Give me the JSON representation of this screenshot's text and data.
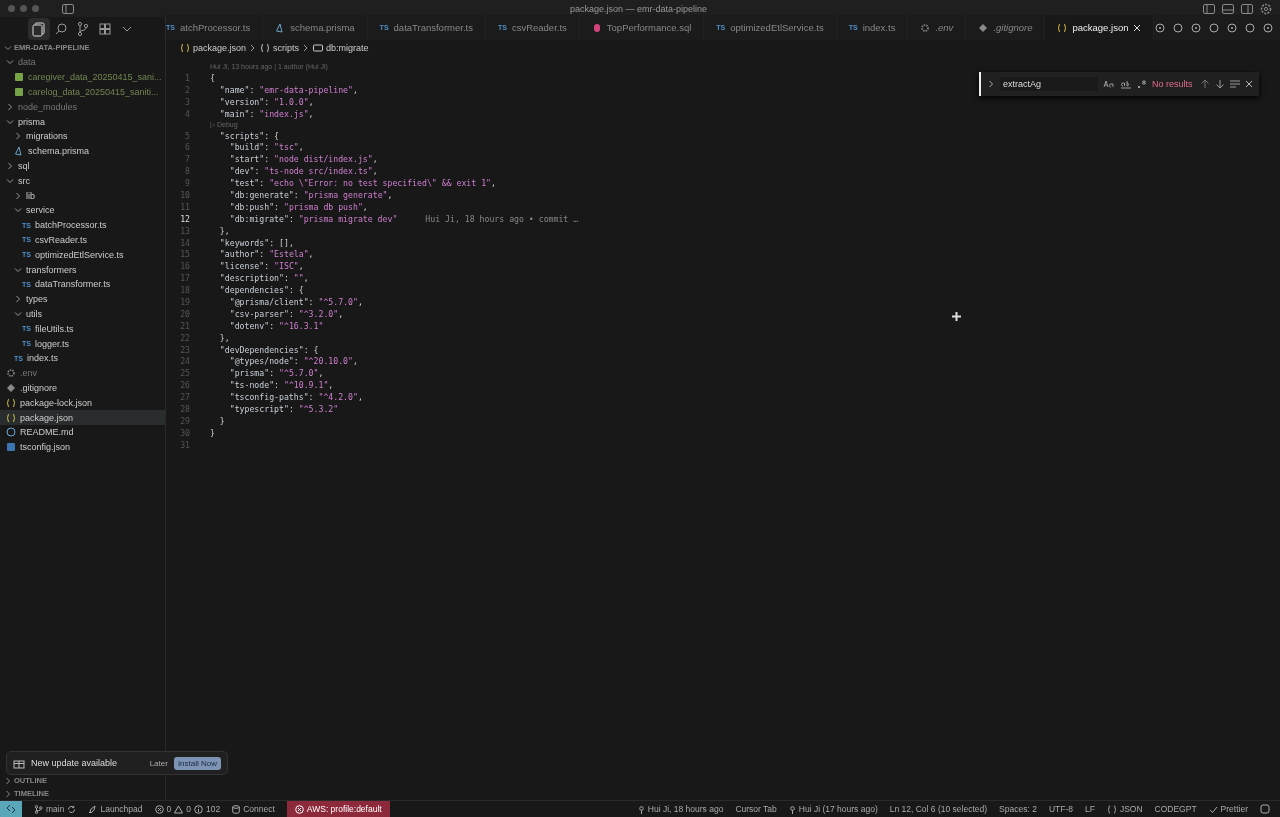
{
  "window": {
    "title": "package.json — emr-data-pipeline"
  },
  "tabs": [
    {
      "label": "atchProcessor.ts",
      "kind": "ts",
      "badge": "TS",
      "selected": false
    },
    {
      "label": "schema.prisma",
      "kind": "prisma",
      "selected": false
    },
    {
      "label": "dataTransformer.ts",
      "kind": "ts",
      "badge": "TS",
      "selected": false
    },
    {
      "label": "csvReader.ts",
      "kind": "ts",
      "badge": "TS",
      "selected": false
    },
    {
      "label": "TopPerformance.sql",
      "kind": "sql",
      "selected": false
    },
    {
      "label": "optimizedEtlService.ts",
      "kind": "ts",
      "badge": "TS",
      "selected": false
    },
    {
      "label": "index.ts",
      "kind": "ts",
      "badge": "TS",
      "selected": false
    },
    {
      "label": ".env",
      "kind": "gear",
      "selected": false
    },
    {
      "label": ".gitignore",
      "kind": "git",
      "selected": false
    },
    {
      "label": "package.json",
      "kind": "json",
      "selected": true
    }
  ],
  "breadcrumbs": [
    {
      "label": "package.json",
      "kind": "json"
    },
    {
      "label": "scripts",
      "kind": "object"
    },
    {
      "label": "db:migrate",
      "kind": "field"
    }
  ],
  "explorer": {
    "title": "EMR-DATA-PIPELINE",
    "items": [
      {
        "name": "data",
        "kind": "folder",
        "expanded": true,
        "dim": true,
        "children": [
          {
            "name": "caregiver_data_20250415_sani...",
            "kind": "csv",
            "dim": true
          },
          {
            "name": "carelog_data_20250415_saniti...",
            "kind": "csv",
            "dim": true
          }
        ]
      },
      {
        "name": "node_modules",
        "kind": "folder",
        "expanded": false,
        "dim": true
      },
      {
        "name": "prisma",
        "kind": "folder",
        "expanded": true,
        "children": [
          {
            "name": "migrations",
            "kind": "folder",
            "expanded": false
          },
          {
            "name": "schema.prisma",
            "kind": "prisma"
          }
        ]
      },
      {
        "name": "sql",
        "kind": "folder",
        "expanded": false
      },
      {
        "name": "src",
        "kind": "folder",
        "expanded": true,
        "children": [
          {
            "name": "lib",
            "kind": "folder",
            "expanded": false
          },
          {
            "name": "service",
            "kind": "folder",
            "expanded": true,
            "children": [
              {
                "name": "batchProcessor.ts",
                "kind": "ts",
                "badge": "TS"
              },
              {
                "name": "csvReader.ts",
                "kind": "ts",
                "badge": "TS"
              },
              {
                "name": "optimizedEtlService.ts",
                "kind": "ts",
                "badge": "TS"
              }
            ]
          },
          {
            "name": "transformers",
            "kind": "folder",
            "expanded": true,
            "children": [
              {
                "name": "dataTransformer.ts",
                "kind": "ts",
                "badge": "TS"
              }
            ]
          },
          {
            "name": "types",
            "kind": "folder",
            "expanded": false
          },
          {
            "name": "utils",
            "kind": "folder",
            "expanded": true,
            "children": [
              {
                "name": "fileUtils.ts",
                "kind": "ts",
                "badge": "TS"
              },
              {
                "name": "logger.ts",
                "kind": "ts",
                "badge": "TS"
              }
            ]
          },
          {
            "name": "index.ts",
            "kind": "ts",
            "badge": "TS"
          }
        ]
      },
      {
        "name": ".env",
        "kind": "gear",
        "dim": true
      },
      {
        "name": ".gitignore",
        "kind": "git"
      },
      {
        "name": "package-lock.json",
        "kind": "json"
      },
      {
        "name": "package.json",
        "kind": "json",
        "selected": true
      },
      {
        "name": "README.md",
        "kind": "info"
      },
      {
        "name": "tsconfig.json",
        "kind": "tsconfig"
      }
    ]
  },
  "panels": [
    "OUTLINE",
    "TIMELINE"
  ],
  "notification": {
    "message": "New update available",
    "secondary": "Later",
    "primary": "Install Now"
  },
  "find": {
    "value": "extractAg",
    "result": "No results"
  },
  "editor": {
    "lines": [
      {
        "lens": "Hui Ji, 13 hours ago | 1 author (Hui Ji)",
        "number": "1",
        "text": "{",
        "current": false
      },
      {
        "number": "2",
        "text": "  \"name\": \"emr-data-pipeline\",",
        "current": false
      },
      {
        "number": "3",
        "text": "  \"version\": \"1.0.0\",",
        "current": false
      },
      {
        "number": "4",
        "text": "  \"main\": \"index.js\",",
        "current": false
      },
      {
        "lens": "▷ Debug",
        "number": "5",
        "text": "  \"scripts\": {",
        "current": false
      },
      {
        "number": "6",
        "text": "    \"build\": \"tsc\",",
        "current": false
      },
      {
        "number": "7",
        "text": "    \"start\": \"node dist/index.js\",",
        "current": false
      },
      {
        "number": "8",
        "text": "    \"dev\": \"ts-node src/index.ts\",",
        "current": false
      },
      {
        "number": "9",
        "text": "    \"test\": \"echo \\\"Error: no test specified\\\" && exit 1\",",
        "current": false
      },
      {
        "number": "10",
        "text": "    \"db:generate\": \"prisma generate\",",
        "current": false
      },
      {
        "number": "11",
        "text": "    \"db:push\": \"prisma db push\",",
        "current": false
      },
      {
        "number": "12",
        "text": "    \"db:migrate\": \"prisma migrate dev\"",
        "current": true,
        "blame": "Hui Ji, 18 hours ago • commit …"
      },
      {
        "number": "13",
        "text": "  },",
        "current": false
      },
      {
        "number": "14",
        "text": "  \"keywords\": [],",
        "current": false
      },
      {
        "number": "15",
        "text": "  \"author\": \"Estela\",",
        "current": false
      },
      {
        "number": "16",
        "text": "  \"license\": \"ISC\",",
        "current": false
      },
      {
        "number": "17",
        "text": "  \"description\": \"\",",
        "current": false
      },
      {
        "number": "18",
        "text": "  \"dependencies\": {",
        "current": false
      },
      {
        "number": "19",
        "text": "    \"@prisma/client\": \"^5.7.0\",",
        "current": false
      },
      {
        "number": "20",
        "text": "    \"csv-parser\": \"^3.2.0\",",
        "current": false
      },
      {
        "number": "21",
        "text": "    \"dotenv\": \"^16.3.1\"",
        "current": false
      },
      {
        "number": "22",
        "text": "  },",
        "current": false
      },
      {
        "number": "23",
        "text": "  \"devDependencies\": {",
        "current": false
      },
      {
        "number": "24",
        "text": "    \"@types/node\": \"^20.10.0\",",
        "current": false
      },
      {
        "number": "25",
        "text": "    \"prisma\": \"^5.7.0\",",
        "current": false
      },
      {
        "number": "26",
        "text": "    \"ts-node\": \"^10.9.1\",",
        "current": false
      },
      {
        "number": "27",
        "text": "    \"tsconfig-paths\": \"^4.2.0\",",
        "current": false
      },
      {
        "number": "28",
        "text": "    \"typescript\": \"^5.3.2\"",
        "current": false
      },
      {
        "number": "29",
        "text": "  }",
        "current": false
      },
      {
        "number": "30",
        "text": "}",
        "current": false
      },
      {
        "number": "31",
        "current": false
      }
    ]
  },
  "status_bar": {
    "left": [
      {
        "kind": "branch",
        "text": "main"
      },
      {
        "kind": "launch",
        "text": "Launchpad"
      },
      {
        "kind": "problems",
        "errors": "0",
        "warnings": "0",
        "infos": "102"
      },
      {
        "kind": "db",
        "text": "Connect"
      },
      {
        "kind": "alert",
        "text": "AWS: profile:default"
      }
    ],
    "right": [
      {
        "kind": "blame",
        "text": "Hui Ji, 18 hours ago"
      },
      {
        "kind": "plain",
        "text": "Cursor Tab"
      },
      {
        "kind": "blame",
        "text": "Hui Ji (17 hours ago)"
      },
      {
        "kind": "plain",
        "text": "Ln 12, Col 6 (10 selected)"
      },
      {
        "kind": "plain",
        "text": "Spaces: 2"
      },
      {
        "kind": "plain",
        "text": "UTF-8"
      },
      {
        "kind": "plain",
        "text": "LF"
      },
      {
        "kind": "lang",
        "text": "JSON"
      },
      {
        "kind": "plain",
        "text": "CODEGPT"
      },
      {
        "kind": "check",
        "text": "Prettier"
      }
    ]
  }
}
